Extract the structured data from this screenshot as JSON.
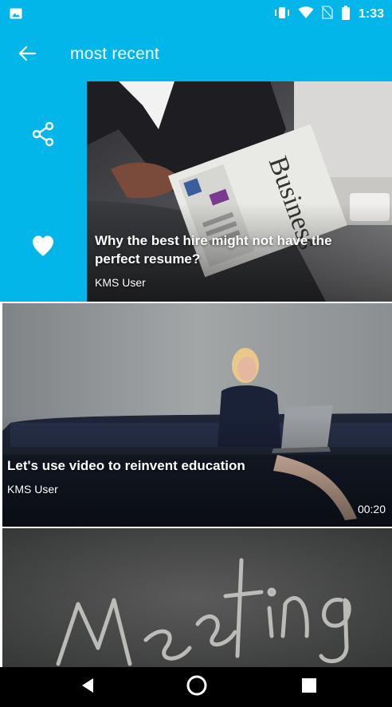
{
  "status_bar": {
    "time": "1:33",
    "icons": [
      "image-notification-icon",
      "vibrate-icon",
      "wifi-icon",
      "no-sim-icon",
      "battery-icon"
    ]
  },
  "app_bar": {
    "title": "most recent",
    "back_icon": "arrow-left-icon"
  },
  "feed": {
    "items": [
      {
        "title": "Why the best hire might not have the perfect resume?",
        "author": "KMS User",
        "image": "man reading Business newspaper",
        "actions": [
          "share-icon",
          "heart-icon"
        ]
      },
      {
        "title": "Let's use video to reinvent education",
        "author": "KMS User",
        "duration": "00:20",
        "image": "woman with laptop on sofa"
      },
      {
        "title": "",
        "author": "",
        "image": "chalkboard with Meeting written"
      }
    ]
  },
  "nav_bar": {
    "buttons": [
      "back-triangle-icon",
      "home-circle-icon",
      "recents-square-icon"
    ]
  },
  "colors": {
    "primary": "#03b6ea",
    "nav": "#000000",
    "text_on_image": "#ffffff"
  }
}
